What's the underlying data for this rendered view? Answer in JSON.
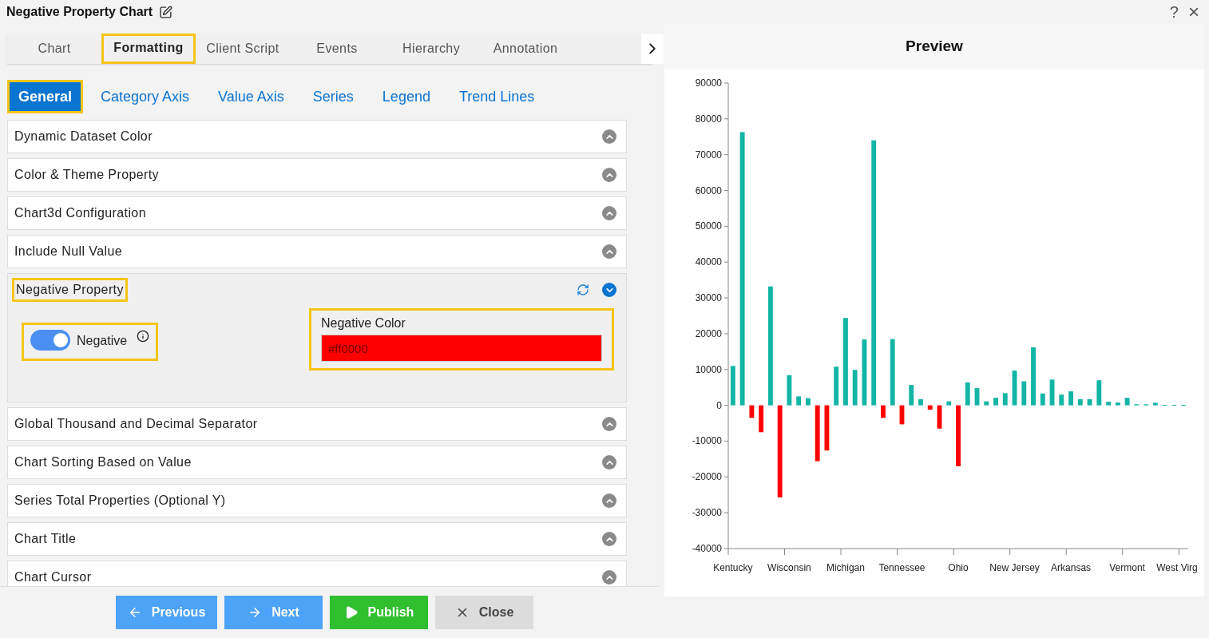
{
  "window": {
    "title": "Negative Property Chart",
    "help": "?",
    "close": "×"
  },
  "tabs": [
    {
      "label": "Chart",
      "selected": false,
      "highlighted": false
    },
    {
      "label": "Formatting",
      "selected": true,
      "highlighted": true
    },
    {
      "label": "Client Script",
      "selected": false,
      "highlighted": false
    },
    {
      "label": "Events",
      "selected": false,
      "highlighted": false
    },
    {
      "label": "Hierarchy",
      "selected": false,
      "highlighted": false
    },
    {
      "label": "Annotation",
      "selected": false,
      "highlighted": false
    }
  ],
  "subtabs": [
    {
      "label": "General",
      "selected": true,
      "highlighted": true
    },
    {
      "label": "Category Axis",
      "selected": false,
      "highlighted": false
    },
    {
      "label": "Value Axis",
      "selected": false,
      "highlighted": false
    },
    {
      "label": "Series",
      "selected": false,
      "highlighted": false
    },
    {
      "label": "Legend",
      "selected": false,
      "highlighted": false
    },
    {
      "label": "Trend Lines",
      "selected": false,
      "highlighted": false
    }
  ],
  "sections": [
    {
      "title": "Dynamic Dataset Color",
      "expanded": false
    },
    {
      "title": "Color & Theme Property",
      "expanded": false
    },
    {
      "title": "Chart3d Configuration",
      "expanded": false
    },
    {
      "title": "Include Null Value",
      "expanded": false
    },
    {
      "title": "Negative Property",
      "expanded": true,
      "highlighted": true,
      "toggle": {
        "label": "Negative",
        "on": true,
        "highlighted": true
      },
      "color_field": {
        "label": "Negative Color",
        "value": "#ff0000",
        "highlighted": true
      }
    },
    {
      "title": "Global Thousand and Decimal Separator",
      "expanded": false
    },
    {
      "title": "Chart Sorting Based on Value",
      "expanded": false
    },
    {
      "title": "Series Total Properties (Optional Y)",
      "expanded": false
    },
    {
      "title": "Chart Title",
      "expanded": false
    },
    {
      "title": "Chart Cursor",
      "expanded": false
    }
  ],
  "buttons": [
    {
      "label": "Previous",
      "kind": "previous"
    },
    {
      "label": "Next",
      "kind": "next"
    },
    {
      "label": "Publish",
      "kind": "publish"
    },
    {
      "label": "Close",
      "kind": "close"
    }
  ],
  "preview": {
    "title": "Preview",
    "chart_data": {
      "type": "bar",
      "categories": [
        "Kentucky",
        null,
        null,
        null,
        null,
        null,
        "Wisconsin",
        null,
        null,
        null,
        null,
        null,
        "Michigan",
        null,
        null,
        null,
        null,
        null,
        "Tennessee",
        null,
        null,
        null,
        null,
        null,
        "Ohio",
        null,
        null,
        null,
        null,
        null,
        "New Jersey",
        null,
        null,
        null,
        null,
        null,
        "Arkansas",
        null,
        null,
        null,
        null,
        null,
        "Vermont",
        null,
        null,
        null,
        null,
        null,
        "West Virg"
      ],
      "stacked": true,
      "series": [
        {
          "color": "#13b5a5",
          "values": [
            11000,
            76300,
            null,
            null,
            33200,
            null,
            8400,
            2500,
            2000,
            null,
            null,
            10800,
            24400,
            9900,
            18400,
            74000,
            null,
            18500,
            null,
            5700,
            1700,
            null,
            null,
            1100,
            null,
            6400,
            4800,
            1100,
            2100,
            3400,
            9700,
            6700,
            16200,
            3300,
            7200,
            3000,
            3900,
            1700,
            1700,
            7000,
            1000,
            800,
            2100,
            300,
            300,
            700,
            100,
            100,
            100
          ]
        },
        {
          "color": "#ff0000",
          "values": [
            null,
            null,
            -3500,
            -7500,
            null,
            -25700,
            null,
            null,
            null,
            -15600,
            -12600,
            null,
            null,
            null,
            null,
            null,
            -3500,
            null,
            -5300,
            null,
            null,
            -1200,
            -6500,
            null,
            -17000,
            null,
            null,
            null,
            null,
            null,
            null,
            null,
            null,
            null,
            null,
            null,
            null,
            null,
            null,
            null,
            null,
            null,
            null,
            null,
            null,
            null,
            null,
            null,
            null
          ]
        }
      ],
      "ylim": [
        -40000,
        90000
      ],
      "yticks": [
        -40000,
        -30000,
        -20000,
        -10000,
        0,
        10000,
        20000,
        30000,
        40000,
        50000,
        60000,
        70000,
        80000,
        90000
      ]
    }
  }
}
